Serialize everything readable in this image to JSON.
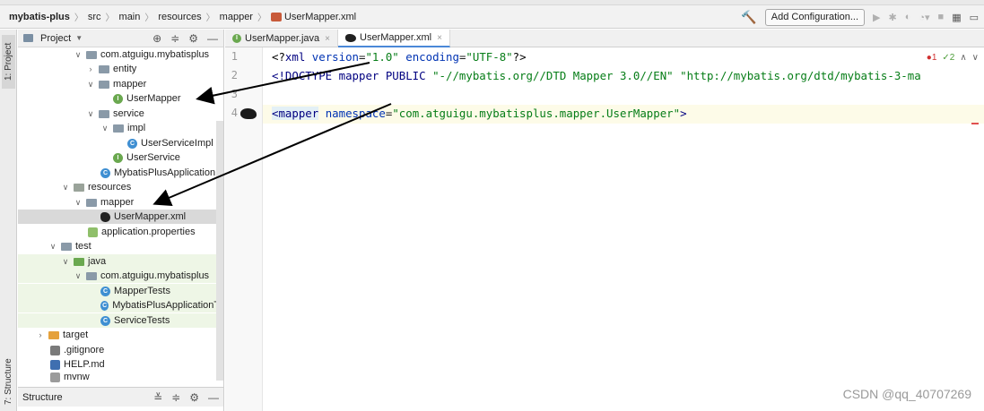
{
  "breadcrumb": {
    "root": "mybatis-plus",
    "items": [
      "src",
      "main",
      "resources",
      "mapper",
      "UserMapper.xml"
    ]
  },
  "toolbar": {
    "add_config_label": "Add Configuration...",
    "hammer_icon": "build-hammer-icon",
    "accent": "#4f9a36"
  },
  "left_stripe": {
    "project_tab": "1: Project",
    "structure_tab": "7: Structure"
  },
  "project_panel": {
    "title": "Project",
    "tree": [
      {
        "label": "com.atguigu.mybatisplus",
        "kind": "package",
        "expanded": true
      },
      {
        "label": "entity",
        "kind": "package",
        "expanded": false
      },
      {
        "label": "mapper",
        "kind": "package",
        "expanded": true
      },
      {
        "label": "UserMapper",
        "kind": "interface"
      },
      {
        "label": "service",
        "kind": "package",
        "expanded": true
      },
      {
        "label": "impl",
        "kind": "package",
        "expanded": true
      },
      {
        "label": "UserServiceImpl",
        "kind": "class"
      },
      {
        "label": "UserService",
        "kind": "interface"
      },
      {
        "label": "MybatisPlusApplication",
        "kind": "class"
      },
      {
        "label": "resources",
        "kind": "folder",
        "expanded": true
      },
      {
        "label": "mapper",
        "kind": "folder",
        "expanded": true
      },
      {
        "label": "UserMapper.xml",
        "kind": "mybatis-xml",
        "selected": true
      },
      {
        "label": "application.properties",
        "kind": "properties"
      },
      {
        "label": "test",
        "kind": "folder",
        "expanded": true
      },
      {
        "label": "java",
        "kind": "test-folder",
        "expanded": true
      },
      {
        "label": "com.atguigu.mybatisplus",
        "kind": "package",
        "expanded": true
      },
      {
        "label": "MapperTests",
        "kind": "class"
      },
      {
        "label": "MybatisPlusApplicationTe",
        "kind": "class"
      },
      {
        "label": "ServiceTests",
        "kind": "class"
      },
      {
        "label": "target",
        "kind": "folder-target",
        "expanded": false
      },
      {
        "label": ".gitignore",
        "kind": "git"
      },
      {
        "label": "HELP.md",
        "kind": "md"
      },
      {
        "label": "mvnw",
        "kind": "file"
      }
    ],
    "structure_title": "Structure"
  },
  "editor": {
    "tabs": [
      {
        "label": "UserMapper.java",
        "active": false
      },
      {
        "label": "UserMapper.xml",
        "active": true
      }
    ],
    "line_numbers": [
      "1",
      "2",
      "3",
      "4"
    ],
    "lines": {
      "l1": {
        "open": "<?",
        "tag": "xml",
        "attr1": "version",
        "val1": "\"1.0\"",
        "attr2": "encoding",
        "val2": "\"UTF-8\"",
        "close": "?>"
      },
      "l2": {
        "open": "<!DOCTYPE",
        "kw1": "mapper",
        "kw2": "PUBLIC",
        "str1": "\"-//mybatis.org//DTD Mapper 3.0//EN\"",
        "str2": "\"http://mybatis.org/dtd/mybatis-3-ma"
      },
      "l4": {
        "open": "<",
        "tag": "mapper",
        "attr": "namespace",
        "val": "\"com.atguigu.mybatisplus.mapper.UserMapper\"",
        "close": ">"
      }
    },
    "inspections": {
      "errors": "1",
      "warnings": "2"
    }
  },
  "watermark": "CSDN @qq_40707269"
}
